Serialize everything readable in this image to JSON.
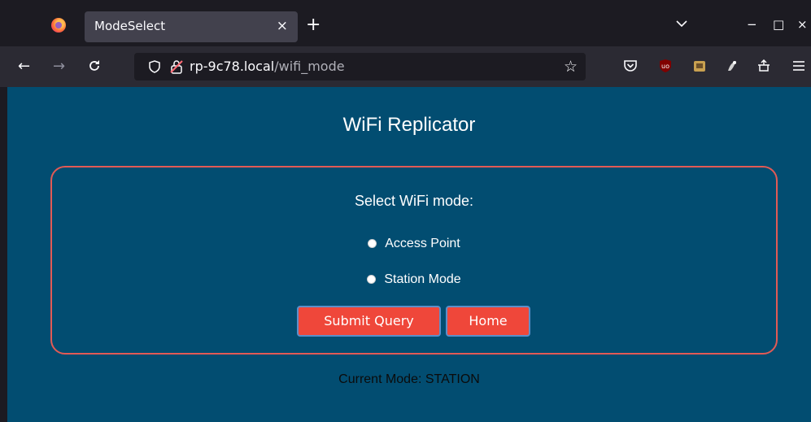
{
  "browser": {
    "tab": {
      "title": "ModeSelect",
      "close_glyph": "×"
    },
    "new_tab_glyph": "+",
    "window_controls": {
      "minimize": "−",
      "maximize": "□",
      "close": "×"
    },
    "nav": {
      "back": "←",
      "forward": "→",
      "reload": "C"
    },
    "url": {
      "host": "rp-9c78.local",
      "path": "/wifi_mode"
    },
    "bookmark_glyph": "☆",
    "toolbar_icons": [
      "pocket-icon",
      "ublock-icon",
      "extension-icon",
      "extension-icon",
      "extensions-puzzle-icon",
      "menu-icon"
    ]
  },
  "page": {
    "title": "WiFi Replicator",
    "form": {
      "heading": "Select WiFi mode:",
      "options": [
        {
          "label": "Access Point",
          "checked": false
        },
        {
          "label": "Station Mode",
          "checked": false
        }
      ],
      "submit_label": "Submit Query",
      "home_label": "Home"
    },
    "status": "Current Mode: STATION"
  },
  "colors": {
    "page_background": "#024d71",
    "box_border": "#e25a55",
    "button_background": "#ef473a",
    "button_border": "#5b8fc9"
  }
}
